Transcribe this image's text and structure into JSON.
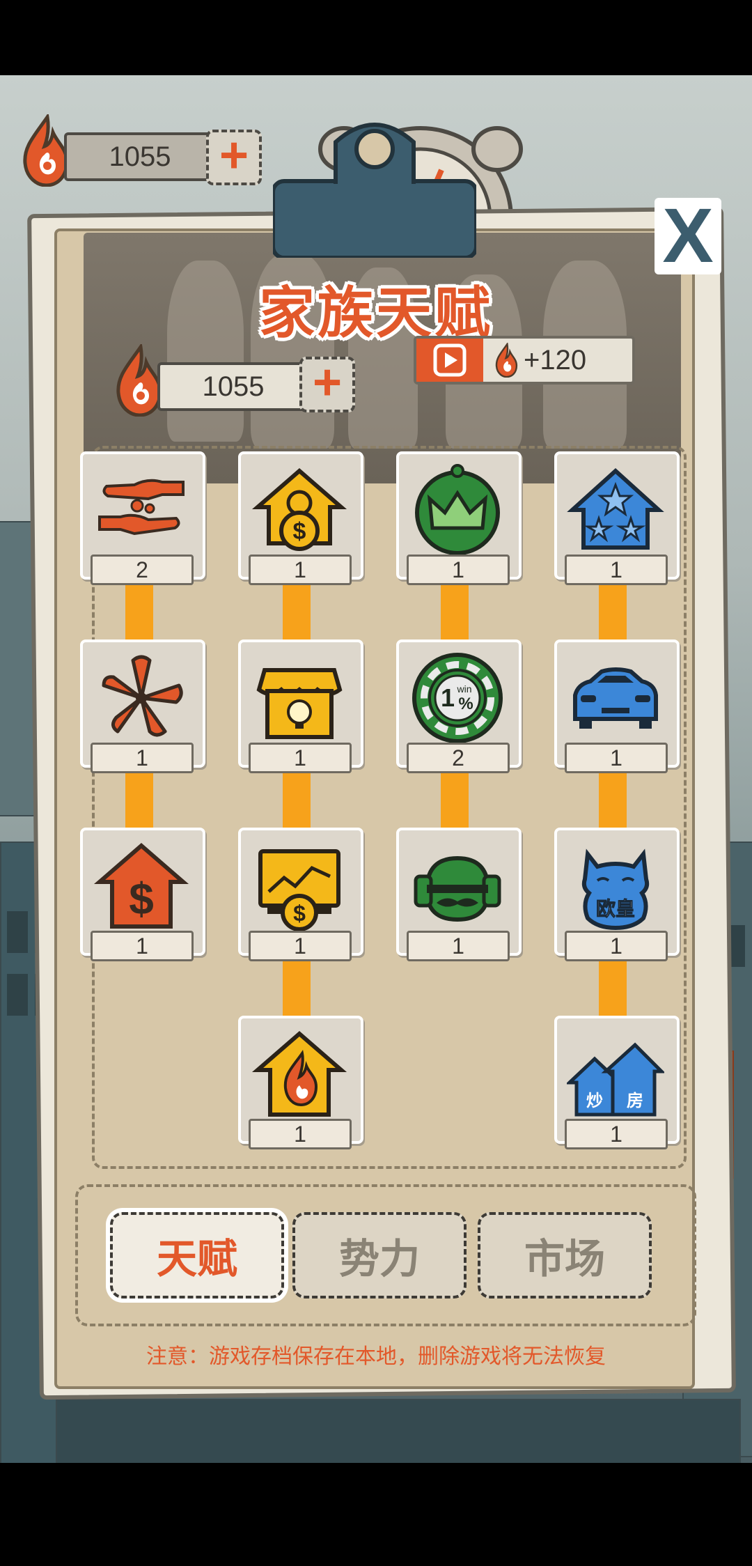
{
  "currency": {
    "amount": "1055",
    "add_symbol": "+"
  },
  "panel": {
    "title": "家族天赋",
    "currency_amount": "1055",
    "add_symbol": "+",
    "ad_reward": "+120",
    "close_symbol": "X"
  },
  "talents": [
    {
      "icon": "hand-coins-icon",
      "level": "2"
    },
    {
      "icon": "house-coin-icon",
      "level": "1"
    },
    {
      "icon": "crown-badge-icon",
      "level": "1"
    },
    {
      "icon": "star-house-icon",
      "level": "1"
    },
    {
      "icon": "flower-icon",
      "level": "1"
    },
    {
      "icon": "shop-idea-icon",
      "level": "1"
    },
    {
      "icon": "poker-chip-icon",
      "level": "2",
      "chip_text": "1",
      "chip_sub": "win",
      "chip_pct": "%"
    },
    {
      "icon": "car-icon",
      "level": "1"
    },
    {
      "icon": "dollar-house-icon",
      "level": "1"
    },
    {
      "icon": "chart-coin-icon",
      "level": "1"
    },
    {
      "icon": "mustache-helmet-icon",
      "level": "1"
    },
    {
      "icon": "lucky-cat-icon",
      "level": "1",
      "cat_text": "欧皇"
    },
    {
      "icon": "flame-house-icon",
      "level": "1"
    },
    {
      "icon": "houses-flip-icon",
      "level": "1",
      "houses_text_1": "炒",
      "houses_text_2": "房"
    }
  ],
  "tabs": [
    {
      "label": "天赋",
      "active": true
    },
    {
      "label": "势力",
      "active": false
    },
    {
      "label": "市场",
      "active": false
    }
  ],
  "notice": "注意：游戏存档保存在本地，删除游戏将无法恢复",
  "colors": {
    "accent": "#e2582a",
    "connector": "#f7a21b",
    "green": "#2f8a3a",
    "blue": "#3c87d8",
    "gold": "#f4b819"
  }
}
